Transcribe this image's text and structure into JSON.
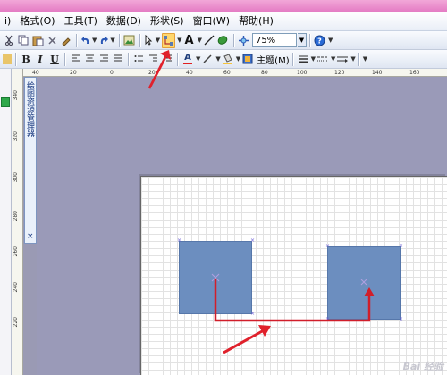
{
  "menubar": {
    "items": [
      {
        "id": "edit",
        "label": "i)"
      },
      {
        "id": "format",
        "label": "格式(O)"
      },
      {
        "id": "tools",
        "label": "工具(T)"
      },
      {
        "id": "data",
        "label": "数据(D)"
      },
      {
        "id": "shape",
        "label": "形状(S)"
      },
      {
        "id": "window",
        "label": "窗口(W)"
      },
      {
        "id": "help",
        "label": "帮助(H)"
      }
    ]
  },
  "toolbar1": {
    "zoom_value": "75%",
    "help_icon": "help-icon"
  },
  "toolbar2": {
    "bold": "B",
    "italic": "I",
    "underline": "U",
    "font_color": "A",
    "topic_label": "主题(M)"
  },
  "explorer": {
    "title": "绘图资源管理器",
    "close": "×"
  },
  "hruler": {
    "ticks": [
      "40",
      "20",
      "0",
      "20",
      "40",
      "60",
      "80",
      "100",
      "120",
      "140",
      "160"
    ]
  },
  "vruler": {
    "ticks": [
      "340",
      "320",
      "300",
      "280",
      "260",
      "240",
      "220"
    ]
  },
  "watermark": "Bai 经验",
  "colors": {
    "shape_fill": "#6c8ebf",
    "connector": "#d11e2a",
    "annotation_arrow": "#e0212c",
    "canvas": "#9a9ab8",
    "highlight": "#ffd76e"
  },
  "diagram": {
    "shape_count": 2,
    "connector": "right-angle connector from shape 1 center to shape 2 center"
  }
}
